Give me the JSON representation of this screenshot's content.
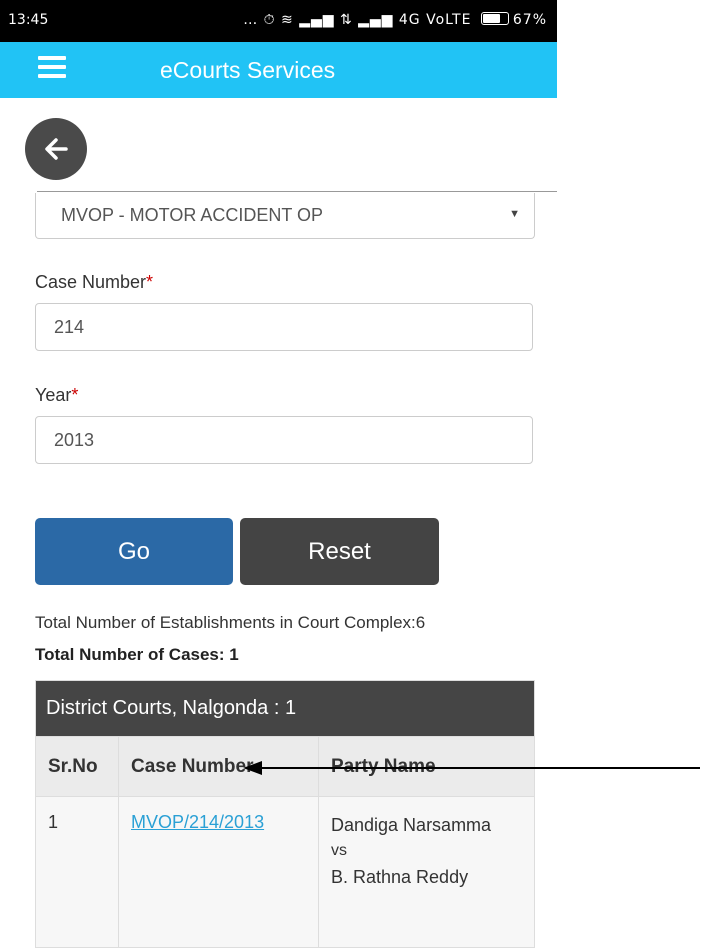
{
  "status_bar": {
    "time": "13:45",
    "network": "4G VoLTE",
    "battery": "67%"
  },
  "app_bar": {
    "title": "eCourts Services"
  },
  "form": {
    "case_type": "MVOP - MOTOR ACCIDENT OP",
    "case_number_label": "Case Number",
    "case_number_value": "214",
    "year_label": "Year",
    "year_value": "2013",
    "required_mark": "*",
    "go_label": "Go",
    "reset_label": "Reset"
  },
  "results": {
    "establishments_text": "Total Number of Establishments in Court Complex:6",
    "cases_text": "Total Number of Cases: 1",
    "table_title": "District Courts, Nalgonda : 1",
    "columns": [
      "Sr.No",
      "Case Number",
      "Party Name"
    ],
    "rows": [
      {
        "sr_no": "1",
        "case_number": "MVOP/214/2013",
        "party_1": "Dandiga Narsamma",
        "vs": "vs",
        "party_2": "B. Rathna Reddy"
      }
    ]
  },
  "icons": {
    "menu": "hamburger-icon",
    "back": "arrow-left-icon"
  }
}
